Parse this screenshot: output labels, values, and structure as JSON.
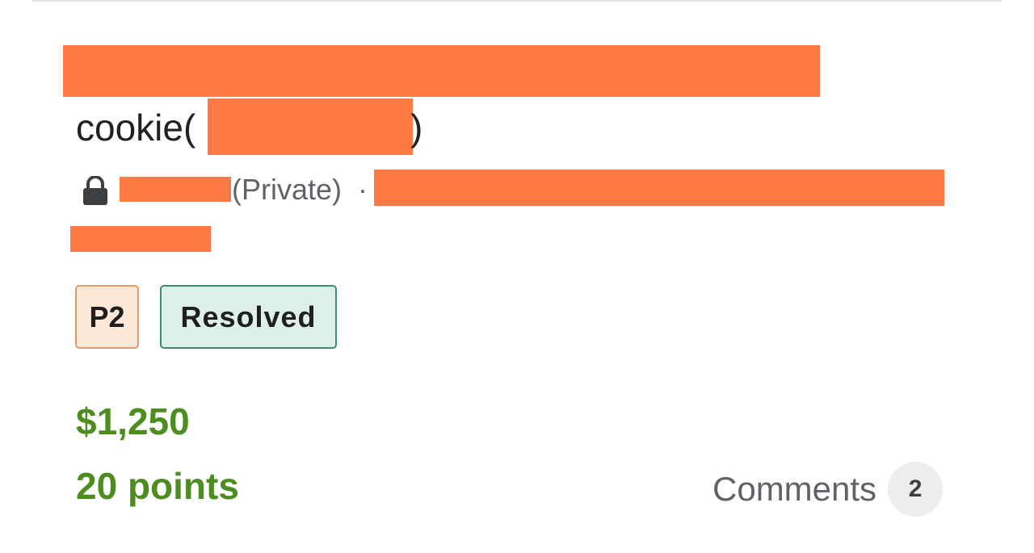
{
  "report": {
    "title_prefix": "cookie(",
    "title_suffix": ")",
    "visibility": "(Private)",
    "separator": "·",
    "priority": "P2",
    "status": "Resolved",
    "bounty": "$1,250",
    "points": "20 points",
    "comments_label": "Comments",
    "comments_count": "2"
  },
  "colors": {
    "redaction": "#ff7a45",
    "reward_green": "#4d8c1f",
    "priority_bg": "#fde8d8",
    "status_bg": "#dcefe9"
  },
  "icons": {
    "visibility_icon": "lock-icon"
  }
}
